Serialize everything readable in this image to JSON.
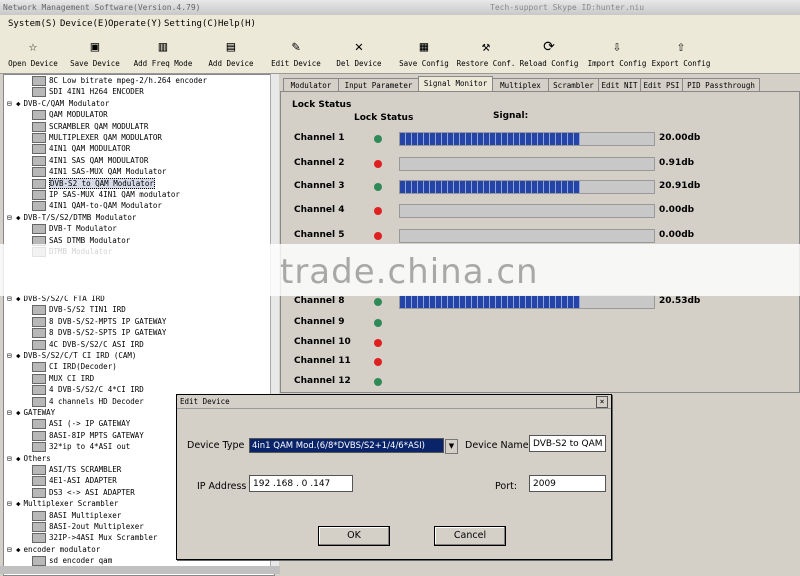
{
  "window": {
    "title": "Network Management Software(Version.4.79)",
    "support": "Tech-support Skype ID:hunter.niu"
  },
  "menu": [
    "System(S)",
    "Device(E)",
    "Operate(Y)",
    "Setting(C)",
    "Help(H)"
  ],
  "toolbar": [
    {
      "label": "Open Device",
      "icon": "open-device-icon",
      "glyph": "☆"
    },
    {
      "label": "Save Device",
      "icon": "save-device-icon",
      "glyph": "▣"
    },
    {
      "label": "Add Freq Mode",
      "icon": "add-freq-mode-icon",
      "glyph": "▥"
    },
    {
      "label": "Add Device",
      "icon": "add-device-icon",
      "glyph": "▤"
    },
    {
      "label": "Edit Device",
      "icon": "edit-device-icon",
      "glyph": "✎"
    },
    {
      "label": "Del Device",
      "icon": "delete-device-icon",
      "glyph": "✕"
    },
    {
      "label": "Save Config",
      "icon": "save-config-icon",
      "glyph": "▦"
    },
    {
      "label": "Restore Conf.",
      "icon": "restore-config-icon",
      "glyph": "⚒"
    },
    {
      "label": "Reload Config",
      "icon": "reload-config-icon",
      "glyph": "⟳"
    },
    {
      "label": "Import Config",
      "icon": "import-config-icon",
      "glyph": "⇩"
    },
    {
      "label": "Export Config",
      "icon": "export-config-icon",
      "glyph": "⇧"
    }
  ],
  "tree": [
    {
      "text": "8C Low bitrate mpeg-2/h.264 encoder",
      "level": 2
    },
    {
      "text": "SDI 4IN1 H264 ENCODER",
      "level": 2
    },
    {
      "text": "DVB-C/QAM Modulator",
      "level": 1
    },
    {
      "text": "QAM MODULATOR",
      "level": 2
    },
    {
      "text": "SCRAMBLER QAM MODULATR",
      "level": 2
    },
    {
      "text": "MULTIPLEXER QAM MODULATOR",
      "level": 2
    },
    {
      "text": "4IN1 QAM MODULATOR",
      "level": 2
    },
    {
      "text": "4IN1 SAS QAM MODULATOR",
      "level": 2
    },
    {
      "text": "4IN1 SAS-MUX QAM Modulator",
      "level": 2
    },
    {
      "text": "DVB-S2 to QAM Modulator",
      "level": 2,
      "selected": true
    },
    {
      "text": "IP SAS-MUX 4IN1 QAM modulator",
      "level": 2
    },
    {
      "text": "4IN1 QAM-to-QAM Modulator",
      "level": 2
    },
    {
      "text": "DVB-T/S/S2/DTMB Modulator",
      "level": 1
    },
    {
      "text": "DVB-T Modulator",
      "level": 2
    },
    {
      "text": "SAS DTMB Modulator",
      "level": 2
    },
    {
      "text": "DTMB Modulator",
      "level": 2
    },
    {
      "text": "DVB-S/S2/C FTA IRD",
      "level": 1
    },
    {
      "text": "DVB-S/S2 TIN1 IRD",
      "level": 2
    },
    {
      "text": "8 DVB-S/S2-MPTS IP GATEWAY",
      "level": 2
    },
    {
      "text": "8 DVB-S/S2-SPTS IP GATEWAY",
      "level": 2
    },
    {
      "text": "4C DVB-S/S2/C ASI IRD",
      "level": 2
    },
    {
      "text": "DVB-S/S2/C/T CI IRD (CAM)",
      "level": 1
    },
    {
      "text": "CI IRD(Decoder)",
      "level": 2
    },
    {
      "text": "MUX CI IRD",
      "level": 2
    },
    {
      "text": "4 DVB-S/S2/C 4*CI IRD",
      "level": 2
    },
    {
      "text": "4 channels HD Decoder",
      "level": 2
    },
    {
      "text": "GATEWAY",
      "level": 1
    },
    {
      "text": "ASI (-> IP GATEWAY",
      "level": 2
    },
    {
      "text": "8ASI-8IP MPTS GATEWAY",
      "level": 2
    },
    {
      "text": "32*ip to 4*ASI out",
      "level": 2
    },
    {
      "text": "Others",
      "level": 1
    },
    {
      "text": "ASI/TS SCRAMBLER",
      "level": 2
    },
    {
      "text": "4E1-ASI ADAPTER",
      "level": 2
    },
    {
      "text": "DS3 <-> ASI ADAPTER",
      "level": 2
    },
    {
      "text": "Multiplexer Scrambler",
      "level": 1
    },
    {
      "text": "8ASI Multiplexer",
      "level": 2
    },
    {
      "text": "8ASI-2out Multiplexer",
      "level": 2
    },
    {
      "text": "32IP->4ASI Mux Scrambler",
      "level": 2
    },
    {
      "text": "encoder modulator",
      "level": 1
    },
    {
      "text": "sd encoder qam",
      "level": 2
    }
  ],
  "tabs": [
    "Modulator",
    "Input Parameter",
    "Signal Monitor",
    "Multiplex",
    "Scrambler",
    "Edit NIT",
    "Edit PSI",
    "PID Passthrough"
  ],
  "active_tab": 2,
  "monitor": {
    "group_title": "Lock Status",
    "col_lock": "Lock Status",
    "col_signal": "Signal:",
    "colors": {
      "locked": "#2e8b57",
      "unlocked": "#e02020"
    },
    "channels": [
      {
        "name": "Channel 1",
        "locked": true,
        "signal": 0.71,
        "db": "20.00db"
      },
      {
        "name": "Channel 2",
        "locked": false,
        "signal": 0,
        "db": "0.91db"
      },
      {
        "name": "Channel 3",
        "locked": true,
        "signal": 0.71,
        "db": "20.91db"
      },
      {
        "name": "Channel 4",
        "locked": false,
        "signal": 0,
        "db": "0.00db"
      },
      {
        "name": "Channel 5",
        "locked": false,
        "signal": 0,
        "db": "0.00db"
      },
      {
        "name": "Channel 8",
        "locked": true,
        "signal": 0.71,
        "db": "20.53db"
      },
      {
        "name": "Channel 9",
        "locked": true
      },
      {
        "name": "Channel 10",
        "locked": false
      },
      {
        "name": "Channel 11",
        "locked": false
      },
      {
        "name": "Channel 12",
        "locked": true
      }
    ]
  },
  "watermark": "trade.china.cn",
  "dialog": {
    "title": "Edit Device",
    "close": "×",
    "device_type_label": "Device Type",
    "device_type_value": "4in1 QAM Mod.(6/8*DVBS/S2+1/4/6*ASI)",
    "device_name_label": "Device Name",
    "device_name_value": "DVB-S2 to QAM",
    "ip_label": "IP Address",
    "ip_value": "192 .168 . 0  .147",
    "port_label": "Port:",
    "port_value": "2009",
    "ok": "OK",
    "cancel": "Cancel"
  }
}
